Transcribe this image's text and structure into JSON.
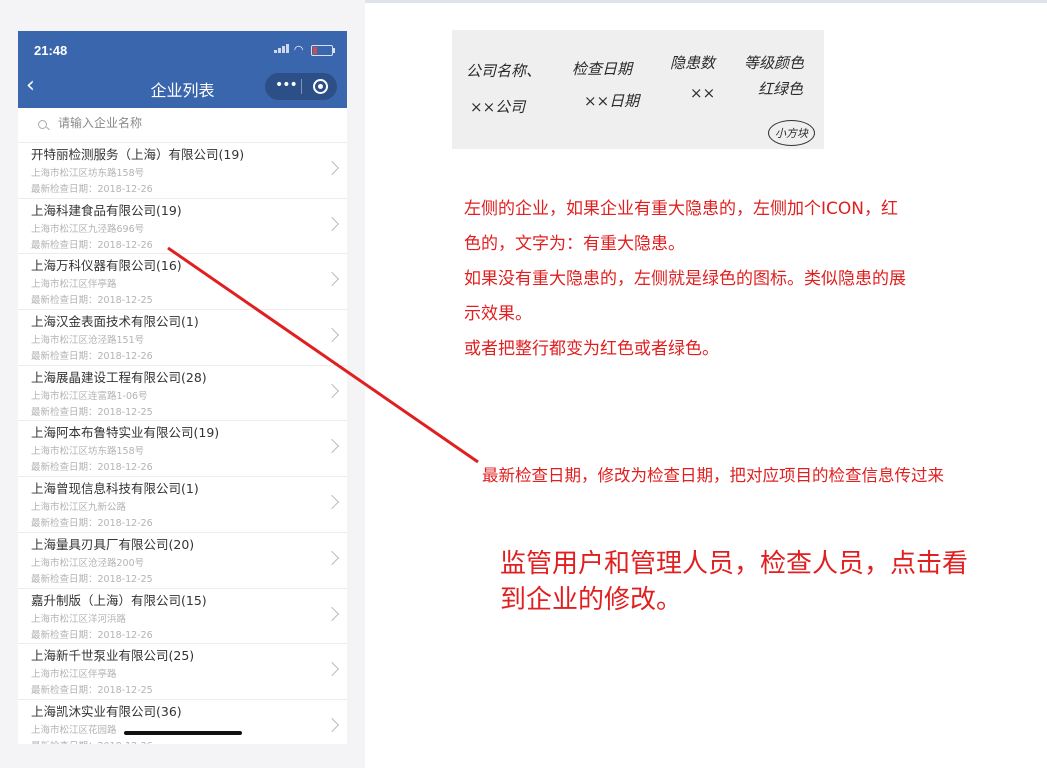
{
  "status_bar": {
    "time": "21:48"
  },
  "nav": {
    "title": "企业列表"
  },
  "search": {
    "placeholder": "请输入企业名称"
  },
  "date_label": "最新检查日期：",
  "companies": [
    {
      "name": "开特丽检测服务（上海）有限公司(19)",
      "address": "上海市松江区坊东路158号",
      "date": "2018-12-26"
    },
    {
      "name": "上海科建食品有限公司(19)",
      "address": "上海市松江区九泾路696号",
      "date": "2018-12-26"
    },
    {
      "name": "上海万科仪器有限公司(16)",
      "address": "上海市松江区伴亭路",
      "date": "2018-12-25"
    },
    {
      "name": "上海汉金表面技术有限公司(1)",
      "address": "上海市松江区沧泾路151号",
      "date": "2018-12-26"
    },
    {
      "name": "上海展晶建设工程有限公司(28)",
      "address": "上海市松江区连富路1-06号",
      "date": "2018-12-25"
    },
    {
      "name": "上海阿本布鲁特实业有限公司(19)",
      "address": "上海市松江区坊东路158号",
      "date": "2018-12-26"
    },
    {
      "name": "上海曾现信息科技有限公司(1)",
      "address": "上海市松江区九新公路",
      "date": "2018-12-26"
    },
    {
      "name": "上海量具刃具厂有限公司(20)",
      "address": "上海市松江区沧泾路200号",
      "date": "2018-12-25"
    },
    {
      "name": "嘉升制版（上海）有限公司(15)",
      "address": "上海市松江区洋河浜路",
      "date": "2018-12-26"
    },
    {
      "name": "上海新千世泵业有限公司(25)",
      "address": "上海市松江区伴亭路",
      "date": "2018-12-25"
    },
    {
      "name": "上海凯沐实业有限公司(36)",
      "address": "上海市松江区花园路",
      "date": "2018-12-26"
    }
  ],
  "handwritten_note": {
    "row1": [
      "公司名称、",
      "检查日期",
      "隐患数",
      "等级颜色"
    ],
    "row2": [
      "××公司",
      "××日期",
      "××",
      "红绿色"
    ],
    "signature": "小方块"
  },
  "annotations": {
    "note1_lines": [
      "左侧的企业，如果企业有重大隐患的，左侧加个ICON，红",
      "色的，文字为：有重大隐患。",
      "如果没有重大隐患的，左侧就是绿色的图标。类似隐患的展",
      "示效果。",
      "或者把整行都变为红色或者绿色。"
    ],
    "note2": "最新检查日期，修改为检查日期，把对应项目的检查信息传过来",
    "note3_lines": [
      "监管用户和管理人员，检查人员，点击看",
      "到企业的修改。"
    ]
  },
  "colors": {
    "nav_blue": "#3a66ad",
    "annotation_red": "#e02020"
  }
}
